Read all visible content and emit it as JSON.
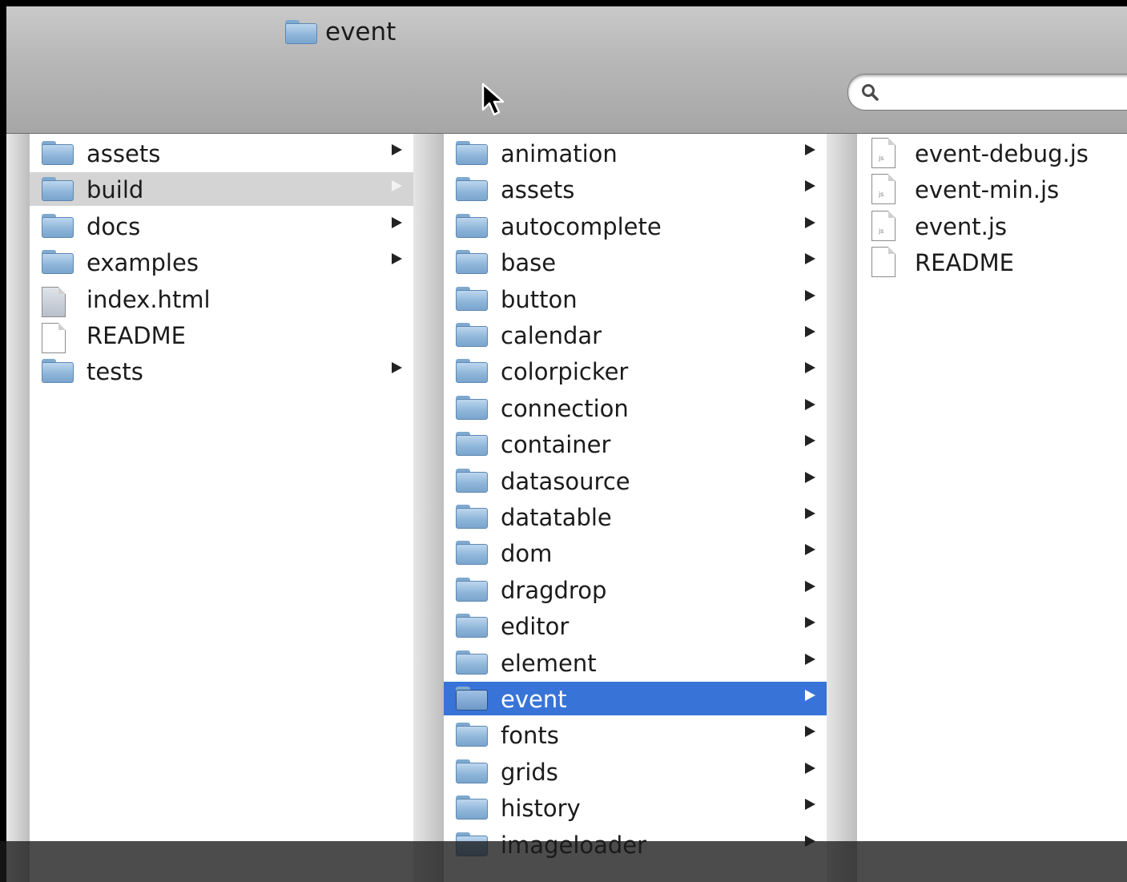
{
  "window": {
    "title": "event"
  },
  "search": {
    "placeholder": "",
    "value": ""
  },
  "columns": [
    {
      "items": [
        {
          "label": "assets",
          "kind": "folder",
          "arrow": true,
          "state": ""
        },
        {
          "label": "build",
          "kind": "folder",
          "arrow": true,
          "state": "dim"
        },
        {
          "label": "docs",
          "kind": "folder",
          "arrow": true,
          "state": ""
        },
        {
          "label": "examples",
          "kind": "folder",
          "arrow": true,
          "state": ""
        },
        {
          "label": "index.html",
          "kind": "html",
          "arrow": false,
          "state": ""
        },
        {
          "label": "README",
          "kind": "doc",
          "arrow": false,
          "state": ""
        },
        {
          "label": "tests",
          "kind": "folder",
          "arrow": true,
          "state": ""
        }
      ]
    },
    {
      "items": [
        {
          "label": "animation",
          "kind": "folder",
          "arrow": true,
          "state": ""
        },
        {
          "label": "assets",
          "kind": "folder",
          "arrow": true,
          "state": ""
        },
        {
          "label": "autocomplete",
          "kind": "folder",
          "arrow": true,
          "state": ""
        },
        {
          "label": "base",
          "kind": "folder",
          "arrow": true,
          "state": ""
        },
        {
          "label": "button",
          "kind": "folder",
          "arrow": true,
          "state": ""
        },
        {
          "label": "calendar",
          "kind": "folder",
          "arrow": true,
          "state": ""
        },
        {
          "label": "colorpicker",
          "kind": "folder",
          "arrow": true,
          "state": ""
        },
        {
          "label": "connection",
          "kind": "folder",
          "arrow": true,
          "state": ""
        },
        {
          "label": "container",
          "kind": "folder",
          "arrow": true,
          "state": ""
        },
        {
          "label": "datasource",
          "kind": "folder",
          "arrow": true,
          "state": ""
        },
        {
          "label": "datatable",
          "kind": "folder",
          "arrow": true,
          "state": ""
        },
        {
          "label": "dom",
          "kind": "folder",
          "arrow": true,
          "state": ""
        },
        {
          "label": "dragdrop",
          "kind": "folder",
          "arrow": true,
          "state": ""
        },
        {
          "label": "editor",
          "kind": "folder",
          "arrow": true,
          "state": ""
        },
        {
          "label": "element",
          "kind": "folder",
          "arrow": true,
          "state": ""
        },
        {
          "label": "event",
          "kind": "folder",
          "arrow": true,
          "state": "sel"
        },
        {
          "label": "fonts",
          "kind": "folder",
          "arrow": true,
          "state": ""
        },
        {
          "label": "grids",
          "kind": "folder",
          "arrow": true,
          "state": ""
        },
        {
          "label": "history",
          "kind": "folder",
          "arrow": true,
          "state": ""
        },
        {
          "label": "imageloader",
          "kind": "folder",
          "arrow": true,
          "state": ""
        }
      ]
    },
    {
      "items": [
        {
          "label": "event-debug.js",
          "kind": "js",
          "arrow": false,
          "state": ""
        },
        {
          "label": "event-min.js",
          "kind": "js",
          "arrow": false,
          "state": ""
        },
        {
          "label": "event.js",
          "kind": "js",
          "arrow": false,
          "state": ""
        },
        {
          "label": "README",
          "kind": "doc",
          "arrow": false,
          "state": ""
        }
      ]
    }
  ],
  "overlay": {
    "text": ""
  },
  "colors": {
    "selection": "#3874d8",
    "selection_inactive": "#d4d4d4",
    "folder": "#8fb6da"
  }
}
